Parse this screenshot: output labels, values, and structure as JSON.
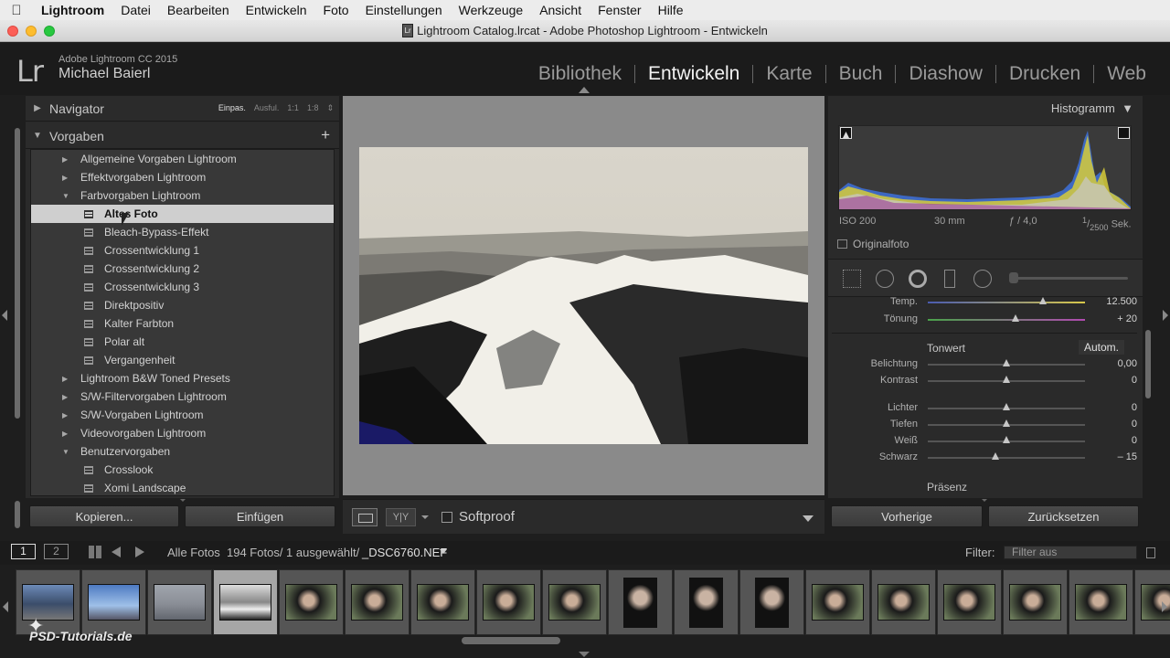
{
  "menu": {
    "app": "Lightroom",
    "items": [
      "Datei",
      "Bearbeiten",
      "Entwickeln",
      "Foto",
      "Einstellungen",
      "Werkzeuge",
      "Ansicht",
      "Fenster",
      "Hilfe"
    ]
  },
  "window": {
    "title": "Lightroom Catalog.lrcat - Adobe Photoshop Lightroom - Entwickeln",
    "doc_icon": "Lr"
  },
  "identity": {
    "logo": "Lr",
    "product": "Adobe Lightroom CC 2015",
    "user": "Michael Baierl"
  },
  "modules": {
    "items": [
      "Bibliothek",
      "Entwickeln",
      "Karte",
      "Buch",
      "Diashow",
      "Drucken",
      "Web"
    ],
    "active": "Entwickeln"
  },
  "left": {
    "navigator": {
      "title": "Navigator",
      "opts": [
        "Einpas.",
        "Ausful.",
        "1:1",
        "1:8"
      ]
    },
    "presets": {
      "title": "Vorgaben",
      "add_symbol": "+",
      "items": [
        {
          "label": "Allgemeine Vorgaben Lightroom",
          "kind": "folder",
          "open": false
        },
        {
          "label": "Effektvorgaben Lightroom",
          "kind": "folder",
          "open": false
        },
        {
          "label": "Farbvorgaben Lightroom",
          "kind": "folder",
          "open": true
        },
        {
          "label": "Altes Foto",
          "kind": "preset",
          "selected": true
        },
        {
          "label": "Bleach-Bypass-Effekt",
          "kind": "preset"
        },
        {
          "label": "Crossentwicklung 1",
          "kind": "preset"
        },
        {
          "label": "Crossentwicklung 2",
          "kind": "preset"
        },
        {
          "label": "Crossentwicklung 3",
          "kind": "preset"
        },
        {
          "label": "Direktpositiv",
          "kind": "preset"
        },
        {
          "label": "Kalter Farbton",
          "kind": "preset"
        },
        {
          "label": "Polar alt",
          "kind": "preset"
        },
        {
          "label": "Vergangenheit",
          "kind": "preset"
        },
        {
          "label": "Lightroom B&W Toned Presets",
          "kind": "folder",
          "open": false
        },
        {
          "label": "S/W-Filtervorgaben Lightroom",
          "kind": "folder",
          "open": false
        },
        {
          "label": "S/W-Vorgaben Lightroom",
          "kind": "folder",
          "open": false
        },
        {
          "label": "Videovorgaben Lightroom",
          "kind": "folder",
          "open": false
        },
        {
          "label": "Benutzervorgaben",
          "kind": "folder",
          "open": true
        },
        {
          "label": "Crosslook",
          "kind": "preset"
        },
        {
          "label": "Xomi Landscape",
          "kind": "preset"
        }
      ]
    },
    "buttons": {
      "copy": "Kopieren...",
      "paste": "Einfügen"
    }
  },
  "center": {
    "softproof": "Softproof",
    "yy": "Y|Y"
  },
  "right": {
    "histogram": {
      "title": "Histogramm",
      "iso": "ISO 200",
      "focal": "30 mm",
      "aperture": "ƒ / 4,0",
      "shutter_num": "1",
      "shutter_den": "2500",
      "shutter_unit": "Sek.",
      "original": "Originalfoto"
    },
    "wb": [
      {
        "label": "Temp.",
        "value": "12.500",
        "pos": 0.73
      },
      {
        "label": "Tönung",
        "value": "+ 20",
        "pos": 0.56
      }
    ],
    "tone": {
      "title": "Tonwert",
      "auto": "Autom."
    },
    "tone_sliders": [
      {
        "label": "Belichtung",
        "value": "0,00",
        "pos": 0.5
      },
      {
        "label": "Kontrast",
        "value": "0",
        "pos": 0.5
      }
    ],
    "tone_sliders2": [
      {
        "label": "Lichter",
        "value": "0",
        "pos": 0.5
      },
      {
        "label": "Tiefen",
        "value": "0",
        "pos": 0.5
      },
      {
        "label": "Weiß",
        "value": "0",
        "pos": 0.5
      },
      {
        "label": "Schwarz",
        "value": "– 15",
        "pos": 0.43
      }
    ],
    "presence": "Präsenz",
    "buttons": {
      "previous": "Vorherige",
      "reset": "Zurücksetzen"
    }
  },
  "filmstrip": {
    "screen1": "1",
    "screen2": "2",
    "source": "Alle Fotos",
    "count": "194 Fotos/ 1 ausgewählt/",
    "filename": "_DSC6760.NEF",
    "filter_label": "Filter:",
    "filter_value": "Filter aus",
    "watermark": "PSD-Tutorials.de",
    "thumb_kinds": [
      "land",
      "land",
      "land",
      "land",
      "land",
      "land",
      "land",
      "land",
      "land",
      "portrait",
      "portrait",
      "portrait",
      "land",
      "land",
      "land",
      "land",
      "land",
      "land"
    ]
  }
}
